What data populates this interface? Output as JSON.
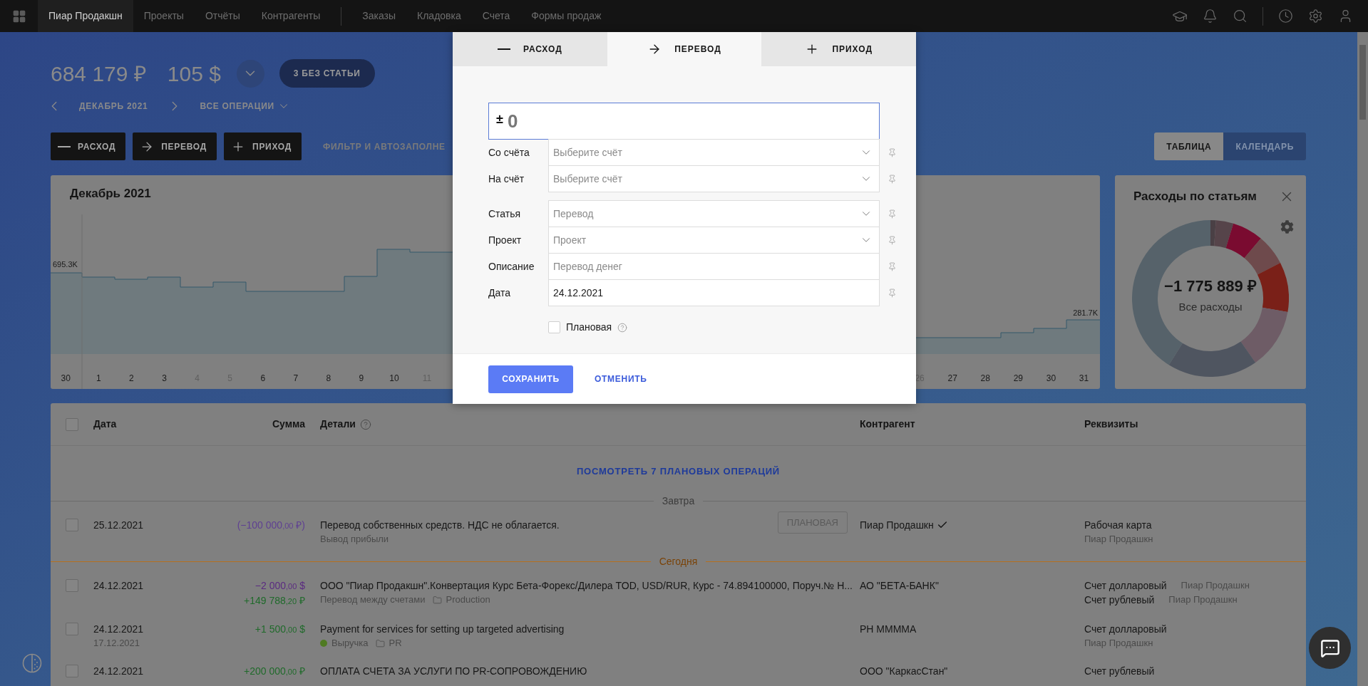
{
  "topbar": {
    "nav_groups": [
      [
        {
          "label": "Пиар Продакшн",
          "selected": true
        },
        {
          "label": "Проекты",
          "selected": false
        },
        {
          "label": "Отчёты",
          "selected": false
        },
        {
          "label": "Контрагенты",
          "selected": false
        }
      ],
      [
        {
          "label": "Заказы",
          "selected": false
        },
        {
          "label": "Кладовка",
          "selected": false
        },
        {
          "label": "Счета",
          "selected": false
        },
        {
          "label": "Формы продаж",
          "selected": false
        }
      ]
    ]
  },
  "summary": {
    "balances": [
      "684 179 ₽",
      "105 $"
    ],
    "badge": "3 БЕЗ СТАТЬИ",
    "period": "ДЕКАБРЬ 2021",
    "operations_filter": "ВСЕ ОПЕРАЦИИ"
  },
  "actions": [
    {
      "kind": "expense",
      "label": "РАСХОД"
    },
    {
      "kind": "transfer",
      "label": "ПЕРЕВОД"
    },
    {
      "kind": "income",
      "label": "ПРИХОД"
    }
  ],
  "filter_link": "ФИЛЬТР И АВТОЗАПОЛНЕ",
  "view_tabs": [
    {
      "label": "ТАБЛИЦА",
      "selected": true
    },
    {
      "label": "КАЛЕНДАРЬ",
      "selected": false
    }
  ],
  "balance_chart": {
    "title": "Декабрь 2021",
    "start_value": "695.3K",
    "end_value": "281.7K",
    "days_left": [
      {
        "label": "30",
        "weekend": false
      },
      {
        "label": "1",
        "weekend": false
      },
      {
        "label": "2",
        "weekend": false
      },
      {
        "label": "3",
        "weekend": false
      },
      {
        "label": "4",
        "weekend": true
      },
      {
        "label": "5",
        "weekend": true
      },
      {
        "label": "6",
        "weekend": false
      },
      {
        "label": "7",
        "weekend": false
      },
      {
        "label": "8",
        "weekend": false
      },
      {
        "label": "9",
        "weekend": false
      },
      {
        "label": "10",
        "weekend": false
      },
      {
        "label": "11",
        "weekend": true
      }
    ],
    "days_right": [
      {
        "label": "26",
        "weekend": true
      },
      {
        "label": "27",
        "weekend": false
      },
      {
        "label": "28",
        "weekend": false
      },
      {
        "label": "29",
        "weekend": false
      },
      {
        "label": "30",
        "weekend": false
      },
      {
        "label": "31",
        "weekend": false
      }
    ]
  },
  "expenses_donut": {
    "title": "Расходы по статьям",
    "total": "−1 775 889 ₽",
    "caption": "Все расходы"
  },
  "table": {
    "select_all_checked": false,
    "columns": [
      "Дата",
      "Сумма",
      "Детали",
      "Контрагент",
      "Реквизиты"
    ],
    "planned_link": "ПОСМОТРЕТЬ 7 ПЛАНОВЫХ ОПЕРАЦИЙ",
    "groups": [
      {
        "label": "Завтра",
        "kind": "future",
        "rows": [
          {
            "checked": false,
            "date": "25.12.2021",
            "amounts": [
              {
                "kind": "planned",
                "main": "(−100 000",
                "fraction": ",00",
                "currency": "₽)"
              }
            ],
            "details": "Перевод собственных средств. НДС не облагается.",
            "tags": [
              {
                "kind": "category",
                "label": "Вывод прибыли"
              }
            ],
            "badge": "ПЛАНОВАЯ",
            "contragent": "Пиар Продашкн",
            "verified": true,
            "requisites": [
              {
                "account": "Рабочая карта",
                "owner": "Пиар Продашкн",
                "inline": false
              }
            ]
          }
        ]
      },
      {
        "label": "Сегодня",
        "kind": "today",
        "rows": [
          {
            "checked": false,
            "date": "24.12.2021",
            "amounts": [
              {
                "kind": "expense",
                "main": "−2 000",
                "fraction": ",00",
                "currency": "$"
              },
              {
                "kind": "income",
                "main": "+149 788",
                "fraction": ",20",
                "currency": "₽"
              }
            ],
            "details": "ООО \"Пиар Продакшн\".Конвертация Курс Бета-Форекс/Дилера TOD, USD/RUR, Курс - 74.894100000, Поруч.№ Н...",
            "tags": [
              {
                "kind": "category",
                "label": "Перевод между счетами"
              },
              {
                "kind": "project",
                "label": "Production"
              }
            ],
            "contragent": "АО \"БЕТА-БАНК\"",
            "verified": false,
            "requisites": [
              {
                "account": "Счет долларовый",
                "owner": "Пиар Продашкн",
                "inline": true
              },
              {
                "account": "Счет рублевый",
                "owner": "Пиар Продашкн",
                "inline": true
              }
            ]
          },
          {
            "checked": false,
            "date": "24.12.2021",
            "date_secondary": "17.12.2021",
            "amounts": [
              {
                "kind": "income",
                "main": "+1 500",
                "fraction": ",00",
                "currency": "$"
              }
            ],
            "details": "Payment for services for setting up targeted advertising",
            "tags": [
              {
                "kind": "category",
                "label": "Выручка",
                "color": "#4f7a22"
              },
              {
                "kind": "project",
                "label": "PR"
              }
            ],
            "contragent": "РН ММММА",
            "verified": false,
            "requisites": [
              {
                "account": "Счет долларовый",
                "owner": "Пиар Продашкн",
                "inline": false
              }
            ]
          },
          {
            "checked": false,
            "date": "24.12.2021",
            "amounts": [
              {
                "kind": "income",
                "main": "+200 000",
                "fraction": ",00",
                "currency": "₽"
              }
            ],
            "details": "ОПЛАТА СЧЕТА ЗА УСЛУГИ ПО PR-СОПРОВОЖДЕНИЮ",
            "contragent": "ООО \"КаркасСтан\"",
            "verified": false,
            "requisites": [
              {
                "account": "Счет рублевый",
                "inline": false
              }
            ]
          }
        ]
      }
    ]
  },
  "transfer_dialog": {
    "tabs": [
      {
        "kind": "expense",
        "label": "РАСХОД",
        "selected": false
      },
      {
        "kind": "transfer",
        "label": "ПЕРЕВОД",
        "selected": true
      },
      {
        "kind": "income",
        "label": "ПРИХОД",
        "selected": false
      }
    ],
    "amount": {
      "sign": "±",
      "value": "0"
    },
    "field_groups": [
      [
        {
          "label": "Со счёта",
          "kind": "select",
          "placeholder": "Выберите счёт"
        },
        {
          "label": "На счёт",
          "kind": "select",
          "placeholder": "Выберите счёт"
        }
      ],
      [
        {
          "label": "Статья",
          "kind": "select",
          "placeholder": "Перевод"
        },
        {
          "label": "Проект",
          "kind": "select",
          "placeholder": "Проект"
        },
        {
          "label": "Описание",
          "kind": "text",
          "placeholder": "Перевод денег"
        },
        {
          "label": "Дата",
          "kind": "text",
          "value": "24.12.2021"
        }
      ]
    ],
    "planned": {
      "label": "Плановая",
      "checked": false
    },
    "save": "СОХРАНИТЬ",
    "cancel": "ОТМЕНИТЬ"
  }
}
